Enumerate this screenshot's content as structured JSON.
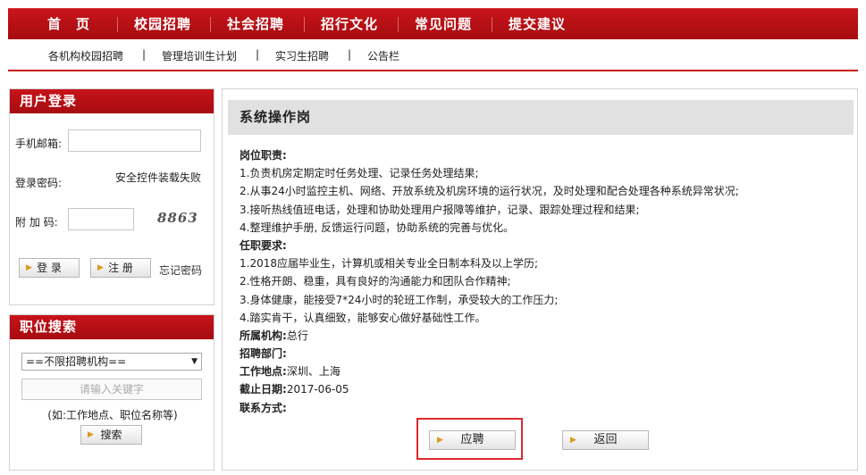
{
  "nav": {
    "items": [
      "首　页",
      "校园招聘",
      "社会招聘",
      "招行文化",
      "常见问题",
      "提交建议"
    ]
  },
  "subnav": {
    "items": [
      "各机构校园招聘",
      "管理培训生计划",
      "实习生招聘",
      "公告栏"
    ],
    "separator": "|"
  },
  "login": {
    "title": "用户登录",
    "phone_email_label": "手机邮箱:",
    "password_label": "登录密码:",
    "security_notice": "安全控件装载失败",
    "captcha_label": "附 加 码:",
    "captcha_value": "8863",
    "login_button": "登 录",
    "register_button": "注 册",
    "forgot_link": "忘记密码"
  },
  "search": {
    "title": "职位搜索",
    "org_select_value": "==不限招聘机构==",
    "keyword_placeholder": "请输入关键字",
    "hint": "(如:工作地点、职位名称等)",
    "search_button": "搜索"
  },
  "job": {
    "title": "系统操作岗",
    "duties_label": "岗位职责:",
    "duties": [
      "1.负责机房定期定时任务处理、记录任务处理结果;",
      "2.从事24小时监控主机、网络、开放系统及机房环境的运行状况，及时处理和配合处理各种系统异常状况;",
      "3.接听热线值班电话，处理和协助处理用户报障等维护，记录、跟踪处理过程和结果;",
      "4.整理维护手册, 反馈运行问题，协助系统的完善与优化。"
    ],
    "requirements_label": "任职要求:",
    "requirements": [
      "1.2018应届毕业生，计算机或相关专业全日制本科及以上学历;",
      "2.性格开朗、稳重，具有良好的沟通能力和团队合作精神;",
      "3.身体健康，能接受7*24小时的轮班工作制，承受较大的工作压力;",
      "4.踏实肯干，认真细致，能够安心做好基础性工作。"
    ],
    "org_label": "所属机构:",
    "org_value": "总行",
    "dept_label": "招聘部门:",
    "dept_value": "",
    "location_label": "工作地点:",
    "location_value": "深圳、上海",
    "deadline_label": "截止日期:",
    "deadline_value": "2017-06-05",
    "contact_label": "联系方式:",
    "contact_value": "",
    "apply_button": "应聘",
    "back_button": "返回"
  },
  "colors": {
    "brand_red": "#c8141a",
    "highlight_border": "#e0292e",
    "button_arrow": "#d99a1e"
  }
}
